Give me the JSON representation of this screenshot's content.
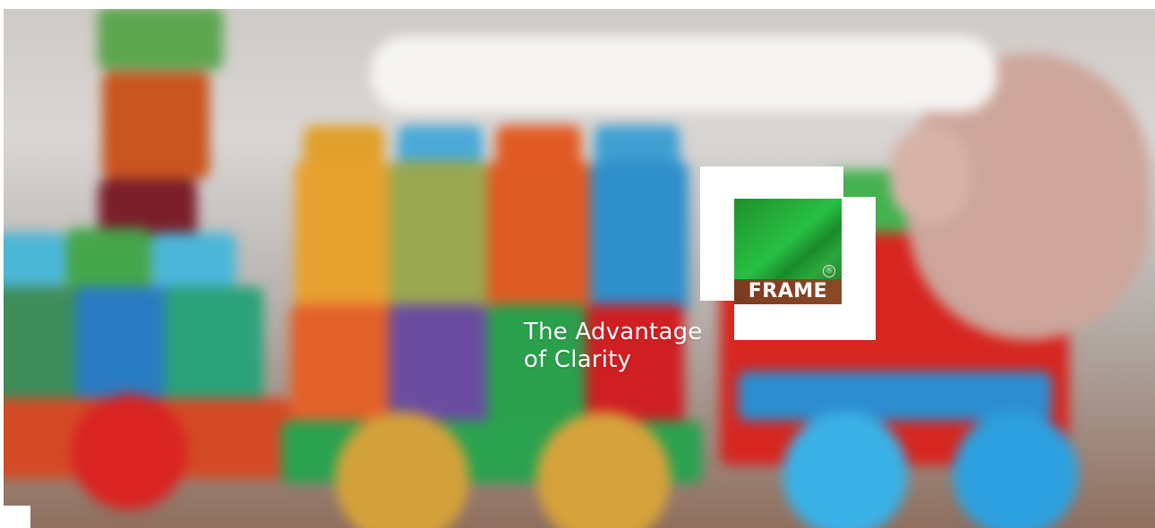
{
  "hero": {
    "tagline_line1": "The Advantage",
    "tagline_line2": "of Clarity"
  },
  "logo": {
    "text": "FRAME",
    "registered_mark": "®"
  },
  "colors": {
    "background": "#ffffff",
    "tagline": "#ffffff",
    "logo_green": "#25b03b",
    "logo_brown": "#7b3b1f"
  }
}
